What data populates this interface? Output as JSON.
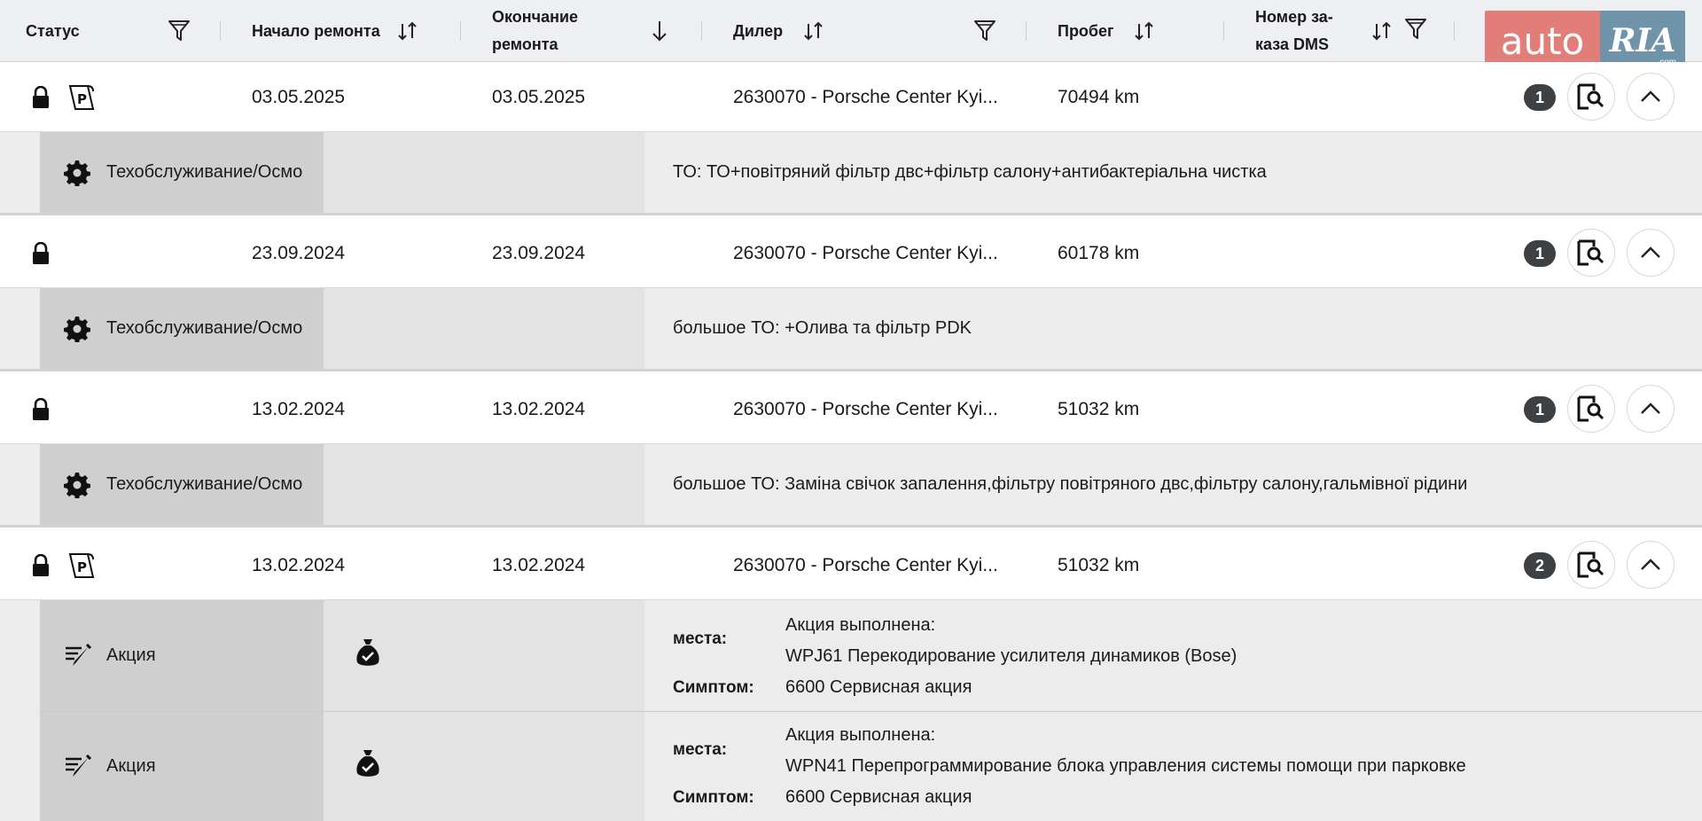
{
  "header": {
    "status": "Статус",
    "start": "Начало ремонта",
    "end_l1": "Окончание",
    "end_l2": "ремонта",
    "dealer": "Дилер",
    "mileage": "Пробег",
    "dms_l1": "Номер за-",
    "dms_l2": "каза DMS"
  },
  "logo": {
    "auto": "auto",
    "ria": "RIA",
    "com": ".com"
  },
  "records": [
    {
      "start": "03.05.2025",
      "end": "03.05.2025",
      "dealer": "2630070 - Porsche Center Kyi...",
      "mileage": "70494 km",
      "count": "1",
      "sub": {
        "type": "Техобслуживание/Осмо",
        "description": "ТО: ТО+повітряний фільтр двс+фільтр салону+антибактеріальна чистка"
      }
    },
    {
      "start": "23.09.2024",
      "end": "23.09.2024",
      "dealer": "2630070 - Porsche Center Kyi...",
      "mileage": "60178 km",
      "count": "1",
      "sub": {
        "type": "Техобслуживание/Осмо",
        "description": "большое ТО: +Олива та фільтр PDK"
      }
    },
    {
      "start": "13.02.2024",
      "end": "13.02.2024",
      "dealer": "2630070 - Porsche Center Kyi...",
      "mileage": "51032 km",
      "count": "1",
      "sub": {
        "type": "Техобслуживание/Осмо",
        "description": "большое ТО: Заміна свічок запалення,фільтру повітряного двс,фільтру салону,гальмівної рідини"
      }
    },
    {
      "start": "13.02.2024",
      "end": "13.02.2024",
      "dealer": "2630070 - Porsche Center Kyi...",
      "mileage": "51032 km",
      "count": "2",
      "subs": [
        {
          "type": "Акция",
          "place_label": "места:",
          "line1": "Акция выполнена:",
          "line2": "WPJ61 Перекодирование усилителя динамиков (Bose)",
          "symptom_label": "Симптом:",
          "symptom": "6600 Сервисная акция"
        },
        {
          "type": "Акция",
          "place_label": "места:",
          "line1": "Акция выполнена:",
          "line2": "WPN41 Перепрограммирование блока управления системы помощи при парковке",
          "symptom_label": "Симптом:",
          "symptom": "6600 Сервисная акция"
        }
      ]
    }
  ]
}
